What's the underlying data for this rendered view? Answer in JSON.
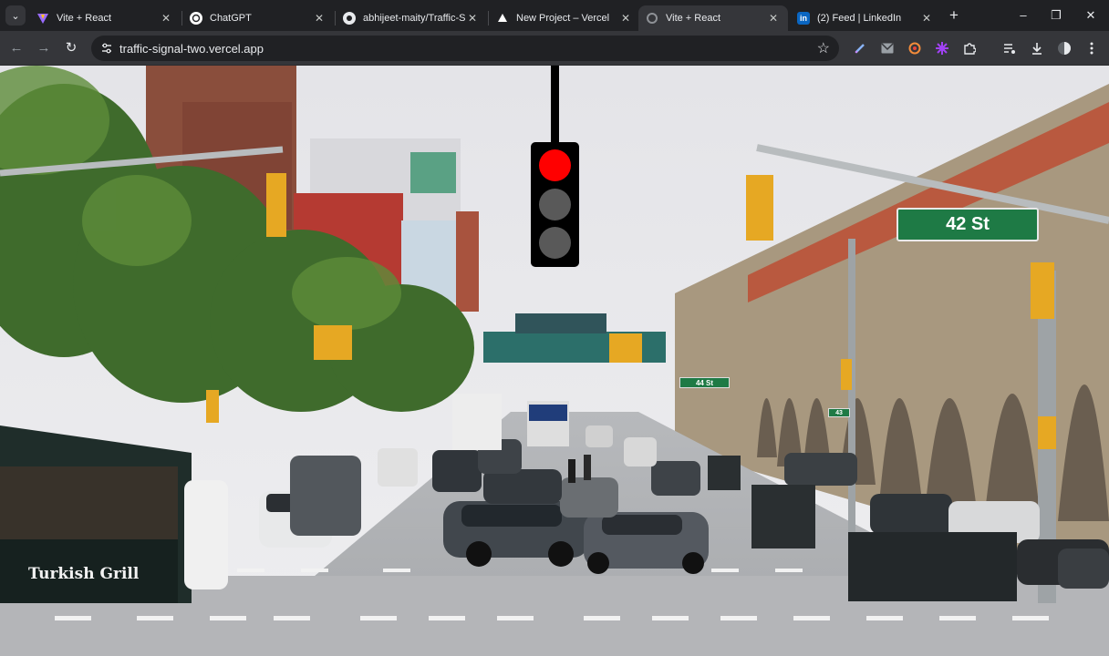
{
  "browser": {
    "tab_search_icon": "chevron-down-icon",
    "tabs": [
      {
        "title": "Vite + React",
        "favicon": "vite-icon",
        "active": false
      },
      {
        "title": "ChatGPT",
        "favicon": "chatgpt-icon",
        "active": false
      },
      {
        "title": "abhijeet-maity/Traffic-Si",
        "favicon": "github-icon",
        "active": false
      },
      {
        "title": "New Project – Vercel",
        "favicon": "vercel-icon",
        "active": false
      },
      {
        "title": "Vite + React",
        "favicon": "loading-icon",
        "active": true
      },
      {
        "title": "(2) Feed | LinkedIn",
        "favicon": "linkedin-icon",
        "active": false
      }
    ],
    "new_tab": "+",
    "window_controls": {
      "minimize": "–",
      "restore": "❐",
      "close": "✕"
    },
    "toolbar": {
      "back": "←",
      "forward": "→",
      "reload": "↻",
      "url": "traffic-signal-two.vercel.app",
      "site_info_icon": "tune-icon",
      "bookmark": "☆",
      "extensions": [
        "pen-icon",
        "gmail-icon",
        "extension-red-icon",
        "extension-purple-icon",
        "puzzle-icon",
        "media-icon",
        "download-icon",
        "profile-icon",
        "menu-icon"
      ]
    }
  },
  "page": {
    "traffic_light": {
      "active": "red",
      "colors": {
        "red": "#ff0000",
        "off": "#595959",
        "housing": "#000000"
      }
    },
    "street_sign_main": "42 St",
    "street_sign_small": "44 St",
    "street_sign_tiny": "43",
    "kiosk_label": "Turkish Grill"
  }
}
